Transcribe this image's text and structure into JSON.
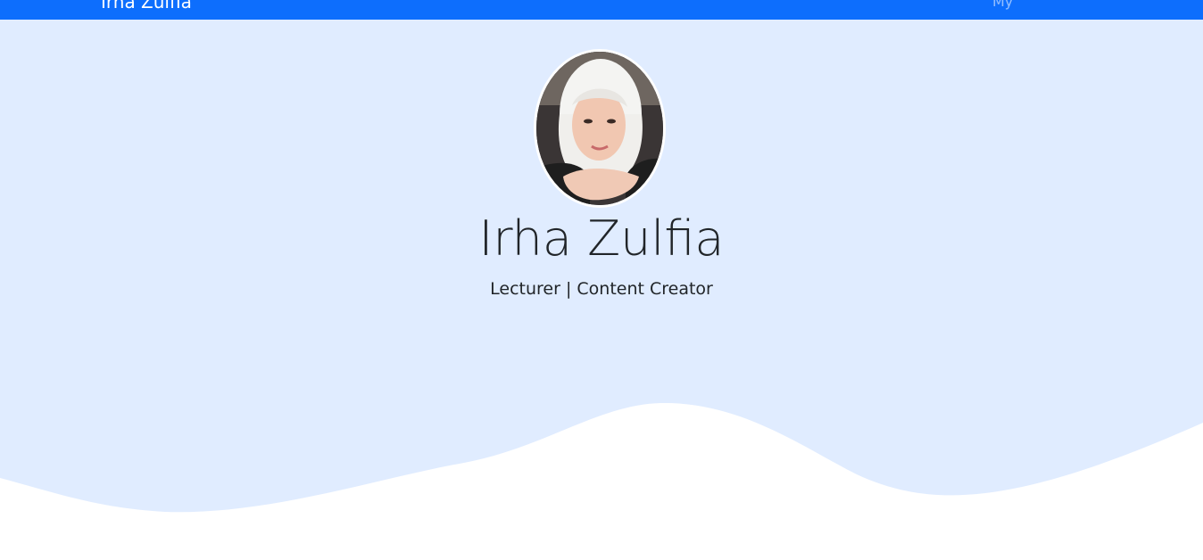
{
  "navbar": {
    "brand": "Irha Zulfia",
    "link": "My",
    "color": "#0d6efd"
  },
  "hero": {
    "background": "#e0ecff",
    "avatar_alt": "profile photo",
    "name": "Irha Zulfia",
    "tagline": "Lecturer | Content Creator"
  }
}
